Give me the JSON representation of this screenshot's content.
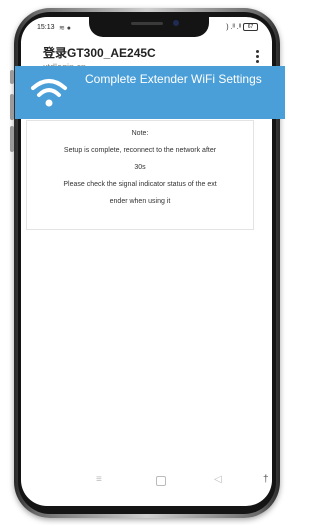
{
  "status_bar": {
    "time": "15:13",
    "left_icons": "≋ ●",
    "right_icons": ") .ᴵᴵ .ᴵᴵ",
    "battery": "67"
  },
  "browser": {
    "page_title": "登录GT300_AE245C",
    "url": "xtdlogin.cn",
    "menu_icon": "vertical-dots-icon"
  },
  "banner": {
    "icon": "wifi-icon",
    "title": "Complete Extender WiFi Settings",
    "color": "#4a9fd8"
  },
  "note": {
    "heading": "Note:",
    "line1": "Setup is complete, reconnect to the network after",
    "line2": "30s",
    "line3": "Please check the signal indicator status of the ext",
    "line4": "ender when using it"
  },
  "nav_bar": {
    "menu_icon": "≡",
    "back_icon": "◁",
    "accessibility_icon": "†"
  }
}
